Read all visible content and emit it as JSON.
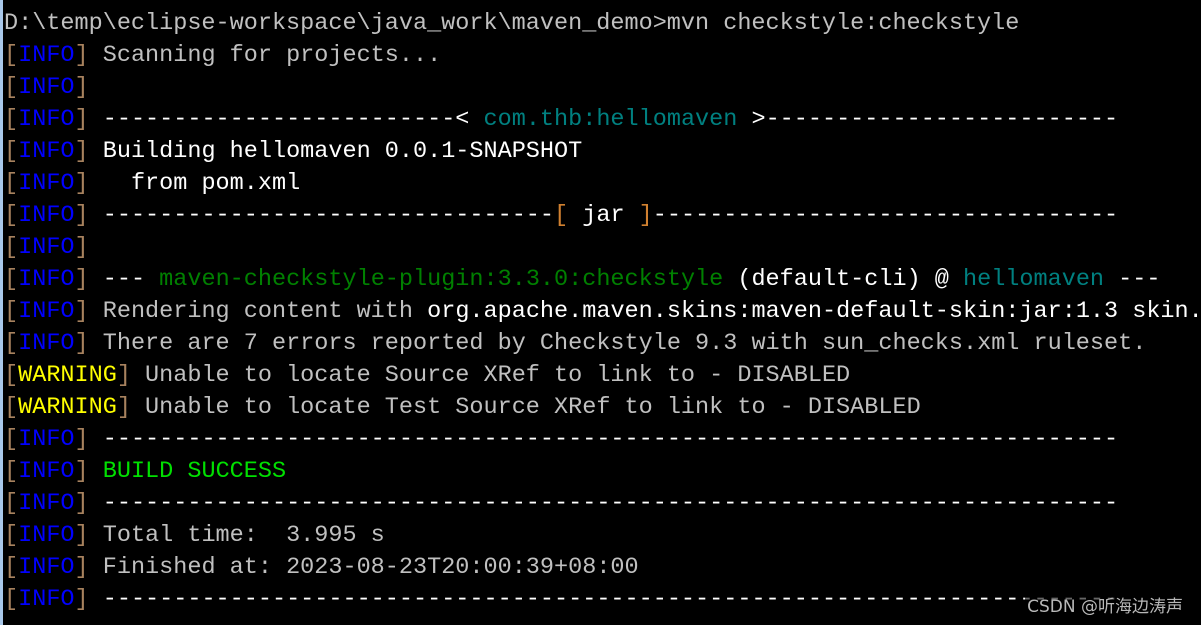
{
  "colors": {
    "background": "#000000",
    "text": "#c0c0c0",
    "info": "#0000ff",
    "warning": "#ffff00",
    "success": "#00e000",
    "plugin": "#008000",
    "artifact": "#008080",
    "bracket": "#a8825e"
  },
  "lines": [
    [
      {
        "t": "D:\\temp\\eclipse-workspace\\java_work\\maven_demo>mvn checkstyle:checkstyle",
        "c": "gray"
      }
    ],
    [
      {
        "t": "[",
        "c": "bracket"
      },
      {
        "t": "INFO",
        "c": "blue"
      },
      {
        "t": "]",
        "c": "bracket"
      },
      {
        "t": " Scanning for projects...",
        "c": "gray"
      }
    ],
    [
      {
        "t": "[",
        "c": "bracket"
      },
      {
        "t": "INFO",
        "c": "blue"
      },
      {
        "t": "]",
        "c": "bracket"
      }
    ],
    [
      {
        "t": "[",
        "c": "bracket"
      },
      {
        "t": "INFO",
        "c": "blue"
      },
      {
        "t": "]",
        "c": "bracket"
      },
      {
        "t": " -------------------------< ",
        "c": "white"
      },
      {
        "t": "com.thb:hellomaven",
        "c": "teal"
      },
      {
        "t": " >-------------------------",
        "c": "white"
      }
    ],
    [
      {
        "t": "[",
        "c": "bracket"
      },
      {
        "t": "INFO",
        "c": "blue"
      },
      {
        "t": "]",
        "c": "bracket"
      },
      {
        "t": " Building hellomaven 0.0.1-SNAPSHOT",
        "c": "white"
      }
    ],
    [
      {
        "t": "[",
        "c": "bracket"
      },
      {
        "t": "INFO",
        "c": "blue"
      },
      {
        "t": "]",
        "c": "bracket"
      },
      {
        "t": "   from pom.xml",
        "c": "white"
      }
    ],
    [
      {
        "t": "[",
        "c": "bracket"
      },
      {
        "t": "INFO",
        "c": "blue"
      },
      {
        "t": "]",
        "c": "bracket"
      },
      {
        "t": " --------------------------------",
        "c": "white"
      },
      {
        "t": "[ ",
        "c": "orange"
      },
      {
        "t": "jar",
        "c": "white"
      },
      {
        "t": " ]",
        "c": "orange"
      },
      {
        "t": "---------------------------------",
        "c": "white"
      }
    ],
    [
      {
        "t": "[",
        "c": "bracket"
      },
      {
        "t": "INFO",
        "c": "blue"
      },
      {
        "t": "]",
        "c": "bracket"
      }
    ],
    [
      {
        "t": "[",
        "c": "bracket"
      },
      {
        "t": "INFO",
        "c": "blue"
      },
      {
        "t": "]",
        "c": "bracket"
      },
      {
        "t": " --- ",
        "c": "white"
      },
      {
        "t": "maven-checkstyle-plugin:3.3.0:checkstyle",
        "c": "green"
      },
      {
        "t": " (default-cli) @ ",
        "c": "white"
      },
      {
        "t": "hellomaven",
        "c": "teal"
      },
      {
        "t": " ---",
        "c": "white"
      }
    ],
    [
      {
        "t": "[",
        "c": "bracket"
      },
      {
        "t": "INFO",
        "c": "blue"
      },
      {
        "t": "]",
        "c": "bracket"
      },
      {
        "t": " Rendering content with ",
        "c": "gray"
      },
      {
        "t": "org.apache.maven.skins:maven-default-skin:jar:1.3 skin.",
        "c": "white"
      }
    ],
    [
      {
        "t": "[",
        "c": "bracket"
      },
      {
        "t": "INFO",
        "c": "blue"
      },
      {
        "t": "]",
        "c": "bracket"
      },
      {
        "t": " There are 7 errors reported by Checkstyle 9.3 with sun_checks.xml ruleset.",
        "c": "gray"
      }
    ],
    [
      {
        "t": "[",
        "c": "bracket"
      },
      {
        "t": "WARNING",
        "c": "yellow"
      },
      {
        "t": "]",
        "c": "bracket"
      },
      {
        "t": " Unable to locate Source XRef to link to - DISABLED",
        "c": "gray"
      }
    ],
    [
      {
        "t": "[",
        "c": "bracket"
      },
      {
        "t": "WARNING",
        "c": "yellow"
      },
      {
        "t": "]",
        "c": "bracket"
      },
      {
        "t": " Unable to locate Test Source XRef to link to - DISABLED",
        "c": "gray"
      }
    ],
    [
      {
        "t": "[",
        "c": "bracket"
      },
      {
        "t": "INFO",
        "c": "blue"
      },
      {
        "t": "]",
        "c": "bracket"
      },
      {
        "t": " ------------------------------------------------------------------------",
        "c": "white"
      }
    ],
    [
      {
        "t": "[",
        "c": "bracket"
      },
      {
        "t": "INFO",
        "c": "blue"
      },
      {
        "t": "]",
        "c": "bracket"
      },
      {
        "t": " ",
        "c": "gray"
      },
      {
        "t": "BUILD SUCCESS",
        "c": "lime"
      }
    ],
    [
      {
        "t": "[",
        "c": "bracket"
      },
      {
        "t": "INFO",
        "c": "blue"
      },
      {
        "t": "]",
        "c": "bracket"
      },
      {
        "t": " ------------------------------------------------------------------------",
        "c": "white"
      }
    ],
    [
      {
        "t": "[",
        "c": "bracket"
      },
      {
        "t": "INFO",
        "c": "blue"
      },
      {
        "t": "]",
        "c": "bracket"
      },
      {
        "t": " Total time:  3.995 s",
        "c": "gray"
      }
    ],
    [
      {
        "t": "[",
        "c": "bracket"
      },
      {
        "t": "INFO",
        "c": "blue"
      },
      {
        "t": "]",
        "c": "bracket"
      },
      {
        "t": " Finished at: 2023-08-23T20:00:39+08:00",
        "c": "gray"
      }
    ],
    [
      {
        "t": "[",
        "c": "bracket"
      },
      {
        "t": "INFO",
        "c": "blue"
      },
      {
        "t": "]",
        "c": "bracket"
      },
      {
        "t": " ------------------------------------------------------------------------",
        "c": "white"
      }
    ]
  ],
  "watermark": "CSDN @听海边涛声"
}
